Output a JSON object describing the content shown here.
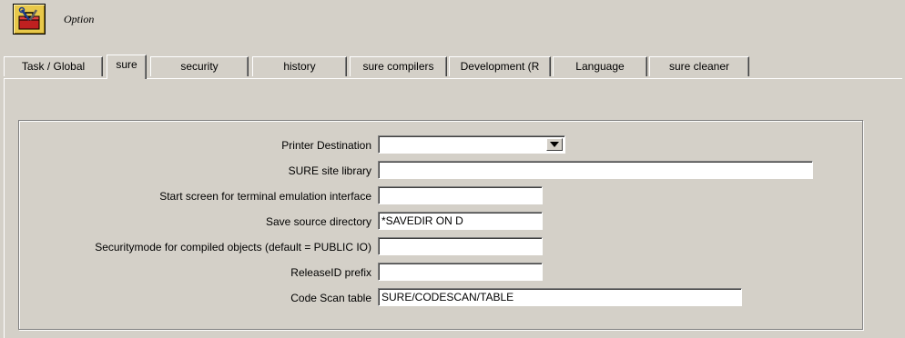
{
  "header": {
    "title": "Option",
    "icon": "toolbox-icon"
  },
  "tabs": [
    {
      "label": "Task / Global",
      "active": false
    },
    {
      "label": "sure",
      "active": true
    },
    {
      "label": "security",
      "active": false
    },
    {
      "label": "history",
      "active": false
    },
    {
      "label": "sure compilers",
      "active": false
    },
    {
      "label": "Development (R",
      "active": false
    },
    {
      "label": "Language",
      "active": false
    },
    {
      "label": "sure cleaner",
      "active": false
    }
  ],
  "form": {
    "printer_destination": {
      "label": "Printer Destination",
      "value": ""
    },
    "sure_site_library": {
      "label": "SURE site library",
      "value": ""
    },
    "start_screen": {
      "label": "Start screen for terminal emulation interface",
      "value": ""
    },
    "save_source_directory": {
      "label": "Save source directory",
      "value": "*SAVEDIR ON D"
    },
    "securitymode": {
      "label": "Securitymode for compiled objects (default = PUBLIC IO)",
      "value": ""
    },
    "releaseid_prefix": {
      "label": "ReleaseID prefix",
      "value": ""
    },
    "code_scan_table": {
      "label": "Code Scan table",
      "value": "SURE/CODESCAN/TABLE"
    }
  },
  "colors": {
    "face": "#d4d0c8",
    "icon_bg": "#e8c84a"
  }
}
